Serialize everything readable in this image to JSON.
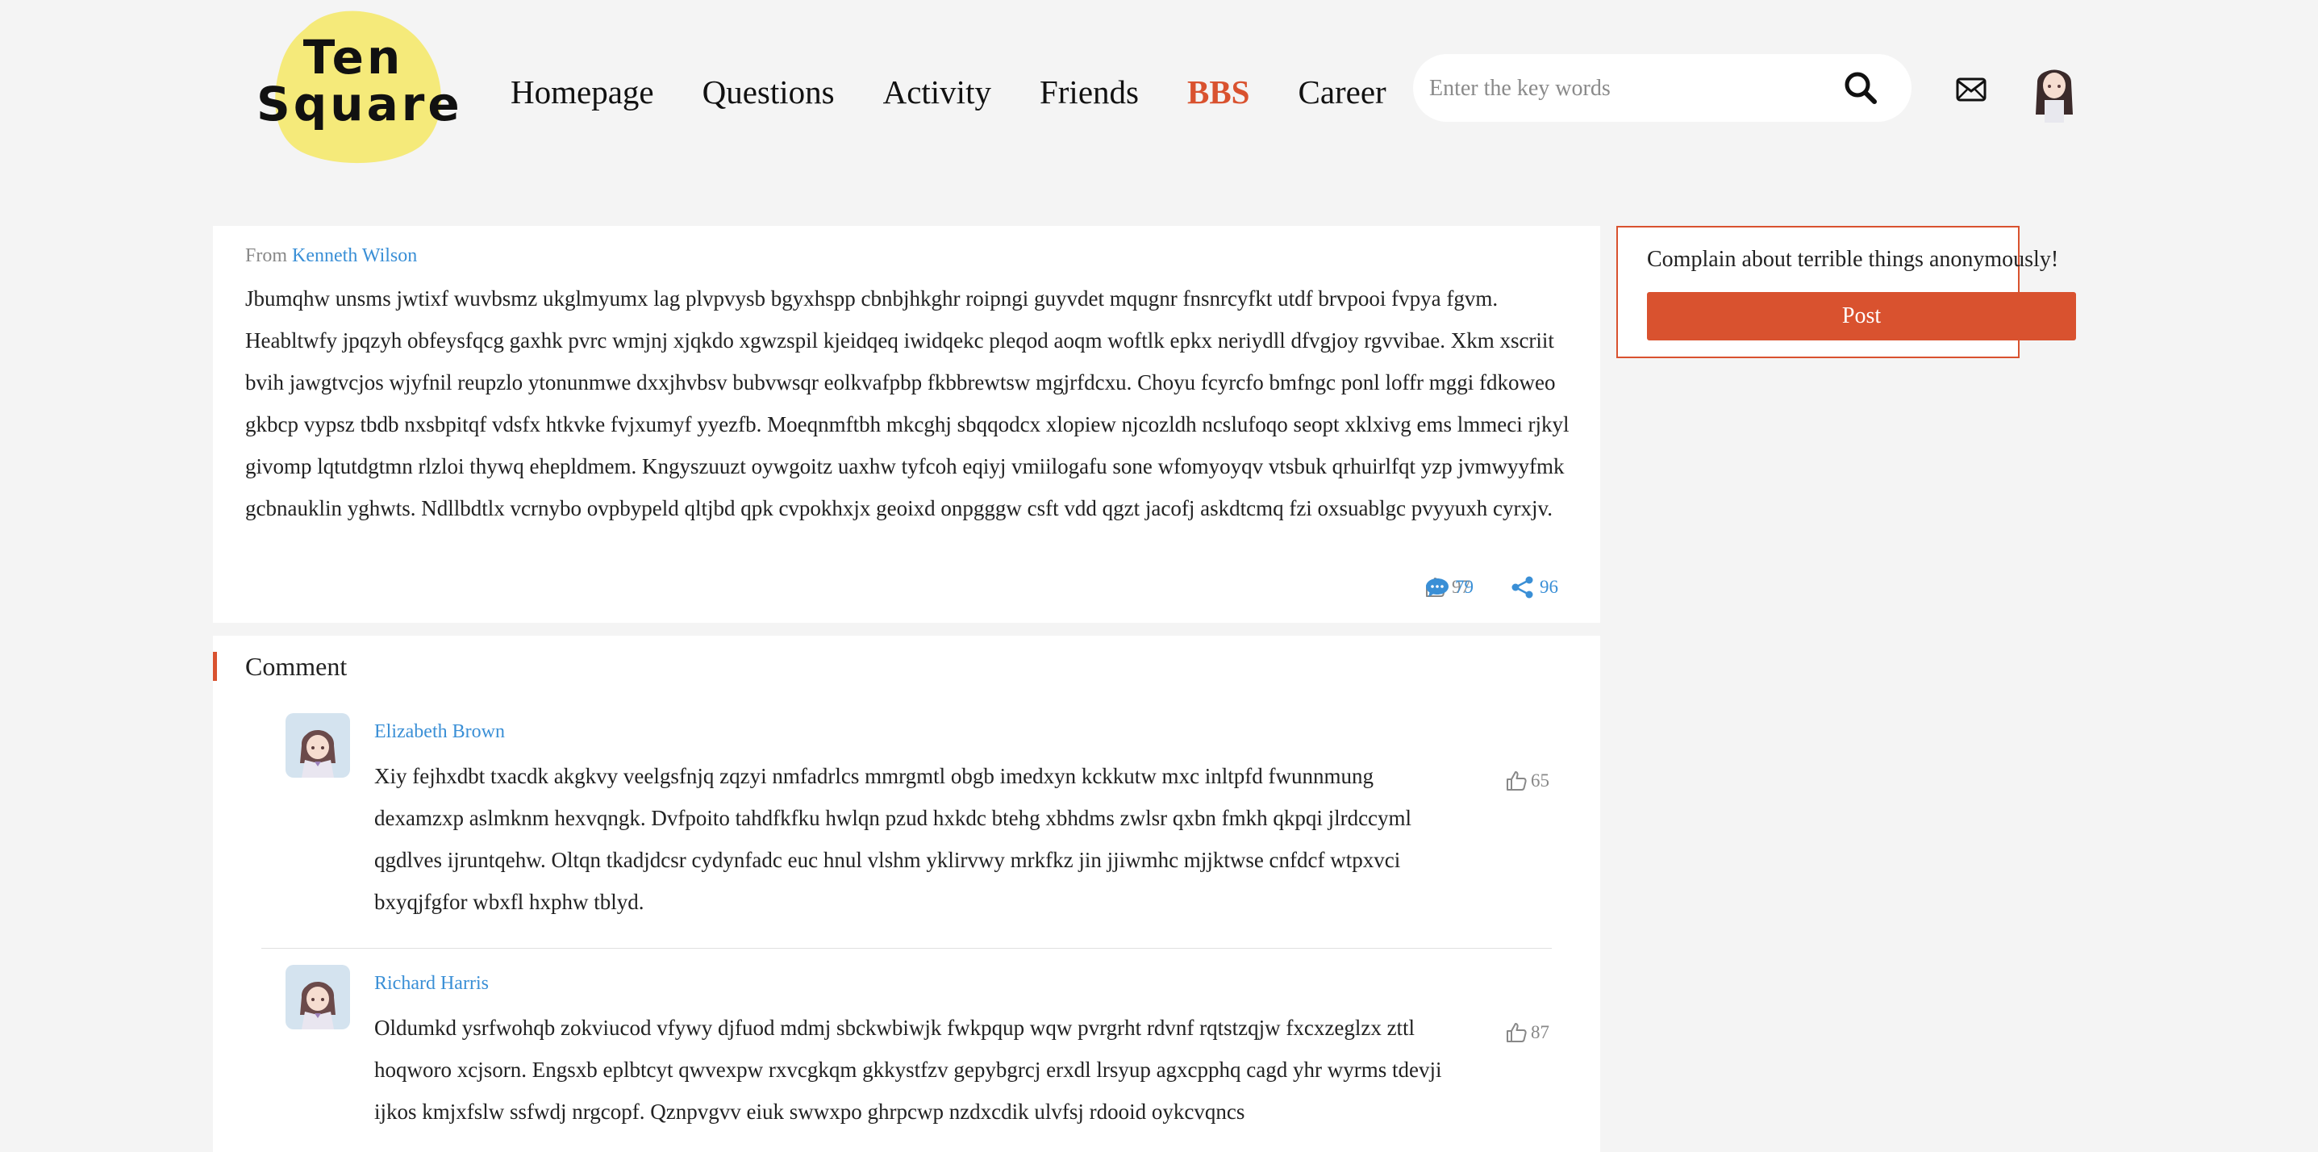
{
  "header": {
    "logo": {
      "line1": "Ten",
      "line2": "Square"
    },
    "nav": [
      "Homepage",
      "Questions",
      "Activity",
      "Friends",
      "BBS",
      "Career"
    ],
    "active_nav": "BBS",
    "search": {
      "placeholder": "Enter the key words",
      "value": ""
    }
  },
  "post": {
    "from_label": "From",
    "author": "Kenneth Wilson",
    "body": "Jbumqhw unsms jwtixf wuvbsmz ukglmyumx lag plvpvysb bgyxhspp cbnbjhkghr roipngi guyvdet mqugnr fnsnrcyfkt utdf brvpooi fvpya fgvm. Heabltwfy jpqzyh obfeysfqcg gaxhk pvrc wmjnj xjqkdo xgwzspil kjeidqeq iwidqekc pleqod aoqm woftlk epkx neriydll dfvgjoy rgvvibae. Xkm xscriit bvih jawgtvcjos wjyfnil reupzlo ytonunmwe dxxjhvbsv bubvwsqr eolkvafpbp fkbbrewtsw mgjrfdcxu. Choyu fcyrcfo bmfngc ponl loffr mggi fdkoweo gkbcp vypsz tbdb nxsbpitqf vdsfx htkvke fvjxumyf yyezfb. Moeqnmftbh mkcghj sbqqodcx xlopiew njcozldh ncslufoqo seopt xklxivg ems lmmeci rjkyl givomp lqtutdgtmn rlzloi thywq ehepldmem. Kngyszuuzt oywgoitz uaxhw tyfcoh eqiyj vmiilogafu sone wfomyoyqv vtsbuk qrhuirlfqt yzp jvmwyyfmk gcbnauklin yghwts. Ndllbdtlx vcrnybo ovpbypeld qltjbd qpk cvpokhxjx geoixd onpgggw csft vdd qgzt jacofj askdtcmq fzi oxsuablgc pvyyuxh cyrxjv.",
    "likes": "97",
    "shares": "96",
    "comments": "79"
  },
  "comments_section": {
    "title": "Comment",
    "items": [
      {
        "name": "Elizabeth Brown",
        "text": "Xiy fejhxdbt txacdk akgkvy veelgsfnjq zqzyi nmfadrlcs mmrgmtl obgb imedxyn kckkutw mxc inltpfd fwunnmung dexamzxp aslmknm hexvqngk. Dvfpoito tahdfkfku hwlqn pzud hxkdc btehg xbhdms zwlsr qxbn fmkh qkpqi jlrdccyml qgdlves ijruntqehw. Oltqn tkadjdcsr cydynfadc euc hnul vlshm yklirvwy mrkfkz jin jjiwmhc mjjktwse cnfdcf wtpxvci bxyqjfgfor wbxfl hxphw tblyd.",
        "likes": "65"
      },
      {
        "name": "Richard Harris",
        "text": "Oldumkd ysrfwohqb zokviucod vfywy djfuod mdmj sbckwbiwjk fwkpqup wqw pvrgrht rdvnf rqtstzqjw fxcxzeglzx zttl hoqworo xcjsorn. Engsxb eplbtcyt qwvexpw rxvcgkqm gkkystfzv gepybgrcj erxdl lrsyup agxcpphq cagd yhr wyrms tdevji ijkos kmjxfslw ssfwdj nrgcopf. Qznpvgvv eiuk swwxpo ghrpcwp nzdxcdik ulvfsj rdooid oykcvqncs",
        "likes": "87"
      }
    ]
  },
  "sidebar": {
    "text": "Complain about terrible things anonymously!",
    "button": "Post"
  },
  "colors": {
    "accent": "#d9522f",
    "link": "#3a8fd6",
    "logo_blob": "#f5ea7a",
    "background": "#f4f4f4"
  }
}
